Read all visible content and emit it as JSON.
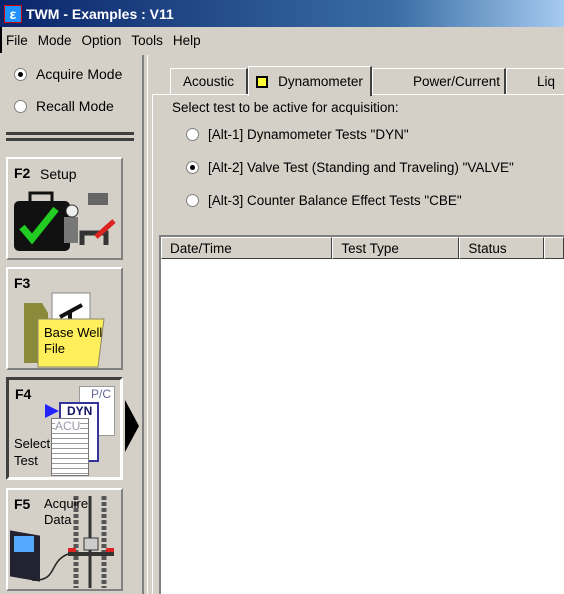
{
  "window": {
    "title": "TWM  -  Examples : V11",
    "icon": "app-icon"
  },
  "menu": [
    "File",
    "Mode",
    "Option",
    "Tools",
    "Help"
  ],
  "mode": {
    "acquire": "Acquire Mode",
    "recall": "Recall Mode",
    "selected": "acquire"
  },
  "fkeys": [
    {
      "key": "F2",
      "label": "Setup",
      "icon": "setup-case-icon"
    },
    {
      "key": "F3",
      "label": "Base Well File",
      "icon": "folder-pumpjack-icon"
    },
    {
      "key": "F4",
      "label": "Select Test",
      "icon": "test-documents-icon",
      "doc_labels": [
        "P/C",
        "DYN",
        "ACU"
      ]
    },
    {
      "key": "F5",
      "label": "Acquire Data",
      "icon": "acquire-instrument-icon"
    }
  ],
  "tabs": [
    {
      "label": "Acoustic"
    },
    {
      "label": "Dynamometer",
      "active": true
    },
    {
      "label": "Power/Current"
    },
    {
      "label": "Liq"
    }
  ],
  "prompt": "Select test to be active for acquisition:",
  "options": [
    {
      "label": "[Alt-1] Dynamometer Tests  \"DYN\"",
      "selected": false
    },
    {
      "label": "[Alt-2] Valve Test (Standing and Traveling)  \"VALVE\"",
      "selected": true
    },
    {
      "label": "[Alt-3] Counter Balance Effect Tests  \"CBE\"",
      "selected": false
    }
  ],
  "table": {
    "columns": [
      "Date/Time",
      "Test Type",
      "Status",
      ""
    ],
    "rows": []
  }
}
